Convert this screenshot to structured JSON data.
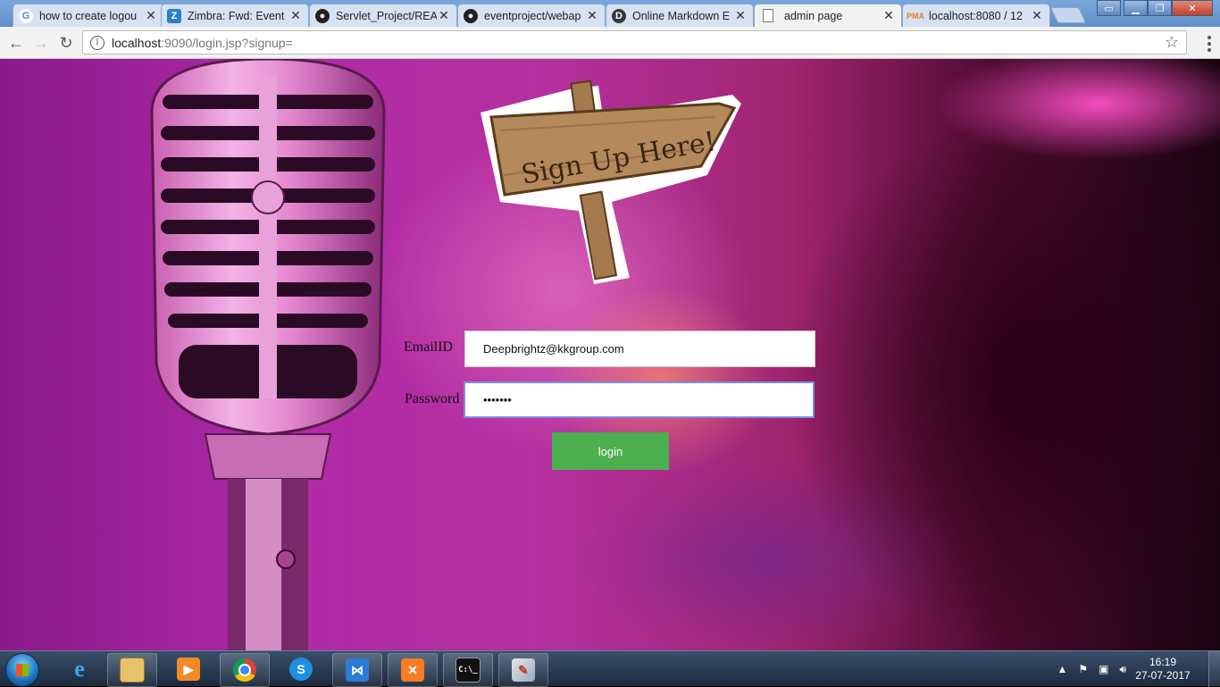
{
  "browser": {
    "tabs": [
      {
        "label": "how to create logou",
        "icon": "google-icon",
        "active": false
      },
      {
        "label": "Zimbra: Fwd: Event",
        "icon": "zimbra-icon",
        "active": false
      },
      {
        "label": "Servlet_Project/REA",
        "icon": "github-icon",
        "active": false
      },
      {
        "label": "eventproject/webap",
        "icon": "github-icon",
        "active": false
      },
      {
        "label": "Online Markdown E",
        "icon": "dillinger-icon",
        "active": false
      },
      {
        "label": "admin page",
        "icon": "page-icon",
        "active": true
      },
      {
        "label": "localhost:8080 / 12",
        "icon": "phpmyadmin-icon",
        "active": false
      }
    ],
    "address": {
      "host": "localhost",
      "rest": ":9090/login.jsp?signup="
    }
  },
  "page": {
    "sign_text": "Sign Up Here!",
    "email_label": "EmailID",
    "email_value": "Deepbrightz@kkgroup.com",
    "password_label": "Password",
    "password_value": "•••••••",
    "login_label": "login"
  },
  "taskbar": {
    "time": "16:19",
    "date": "27-07-2017",
    "apps": [
      "internet-explorer-icon",
      "file-explorer-icon",
      "media-player-icon",
      "chrome-icon",
      "app-s-icon",
      "visual-studio-icon",
      "xampp-icon",
      "cmd-icon",
      "paint-icon"
    ]
  },
  "colors": {
    "login_button": "#4caf50",
    "focus_border": "#7a8fe0"
  }
}
